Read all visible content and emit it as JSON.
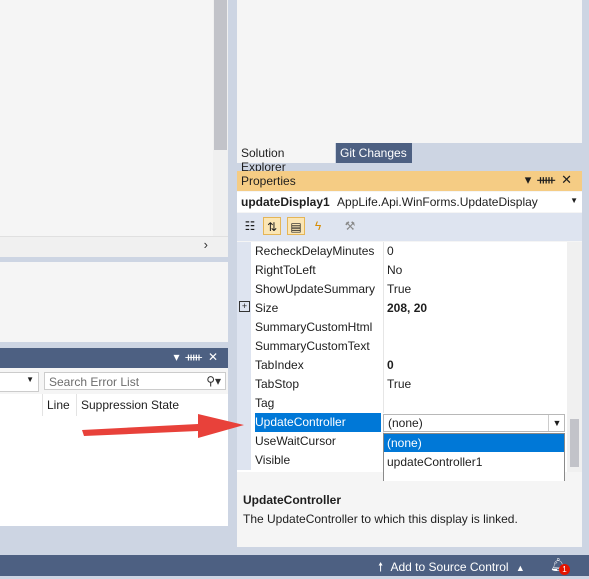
{
  "error_list": {
    "search_placeholder": "Search Error List",
    "columns": [
      "Line",
      "Suppression State"
    ]
  },
  "right_tabs": [
    "Solution Explorer",
    "Git Changes"
  ],
  "properties": {
    "title": "Properties",
    "object_name": "updateDisplay1",
    "object_type": "AppLife.Api.WinForms.UpdateDisplay",
    "rows": [
      {
        "name": "RecheckDelayMinutes",
        "value": "0"
      },
      {
        "name": "RightToLeft",
        "value": "No"
      },
      {
        "name": "ShowUpdateSummary",
        "value": "True"
      },
      {
        "name": "Size",
        "value": "208, 20"
      },
      {
        "name": "SummaryCustomHtml",
        "value": ""
      },
      {
        "name": "SummaryCustomText",
        "value": ""
      },
      {
        "name": "TabIndex",
        "value": "0"
      },
      {
        "name": "TabStop",
        "value": "True"
      },
      {
        "name": "Tag",
        "value": ""
      },
      {
        "name": "UpdateController",
        "value": "(none)"
      },
      {
        "name": "UseWaitCursor",
        "value": ""
      },
      {
        "name": "Visible",
        "value": ""
      }
    ],
    "dropdown_options": [
      "(none)",
      "updateController1"
    ],
    "description_title": "UpdateController",
    "description_text": "The UpdateController to which this display is linked."
  },
  "status_bar": {
    "source_control": "Add to Source Control",
    "notification_count": "1"
  },
  "colors": {
    "accent_blue": "#0078d7",
    "tool_window_header": "#4d6082",
    "active_title": "#f5cc84",
    "arrow_red": "#e8413a"
  }
}
